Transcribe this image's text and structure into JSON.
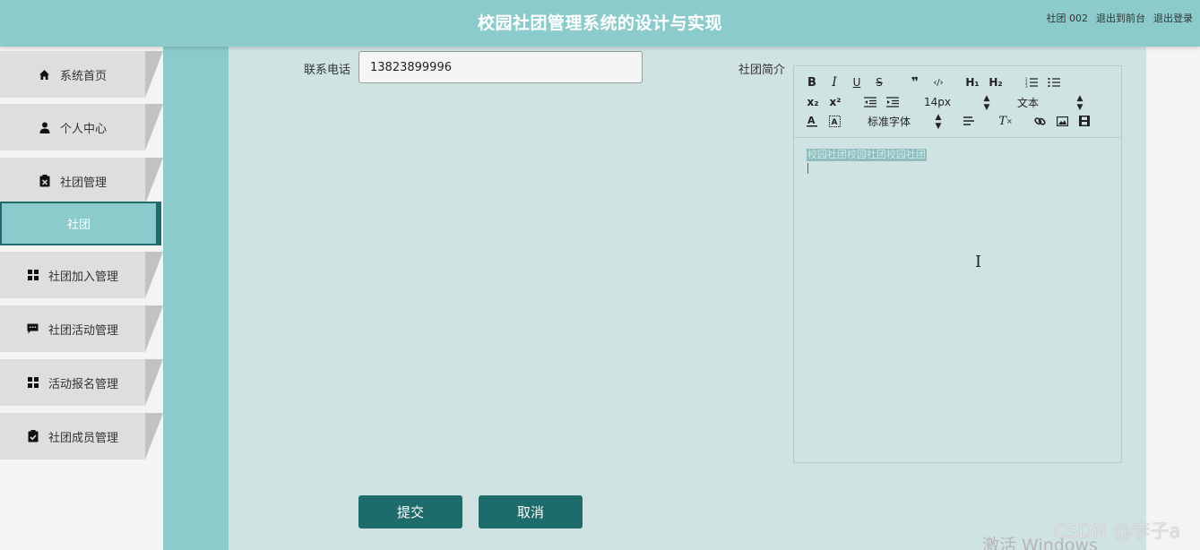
{
  "header": {
    "title": "校园社团管理系统的设计与实现",
    "user": "社团 002",
    "to_frontend": "退出到前台",
    "logout": "退出登录"
  },
  "sidebar": {
    "items": [
      {
        "label": "系统首页",
        "icon": "home-icon"
      },
      {
        "label": "个人中心",
        "icon": "user-icon"
      },
      {
        "label": "社团管理",
        "icon": "clipboard-x-icon"
      },
      {
        "label": "社团加入管理",
        "icon": "grid-icon"
      },
      {
        "label": "社团活动管理",
        "icon": "message-icon"
      },
      {
        "label": "活动报名管理",
        "icon": "grid-icon"
      },
      {
        "label": "社团成员管理",
        "icon": "clipboard-check-icon"
      }
    ],
    "active_sub": "社团"
  },
  "form": {
    "phone_label": "联系电话",
    "phone_value": "13823899996",
    "intro_label": "社团简介",
    "editor_content": "校园社团校园社团校园社团",
    "toolbar": {
      "bold": "B",
      "italic": "I",
      "underline": "U",
      "strike": "S",
      "quote": "❞",
      "code": "‹/›",
      "h1": "H₁",
      "h2": "H₂",
      "sub": "x₂",
      "sup": "x²",
      "size_value": "14px",
      "header_value": "文本",
      "font_value": "标准字体"
    },
    "submit": "提交",
    "cancel": "取消"
  },
  "watermarks": {
    "windows": "激活 Windows",
    "csdn": "CSDN @李子a"
  },
  "colors": {
    "header": "#8ccbcb",
    "main_bg": "#cfe3e3",
    "button": "#1e6b6b"
  }
}
